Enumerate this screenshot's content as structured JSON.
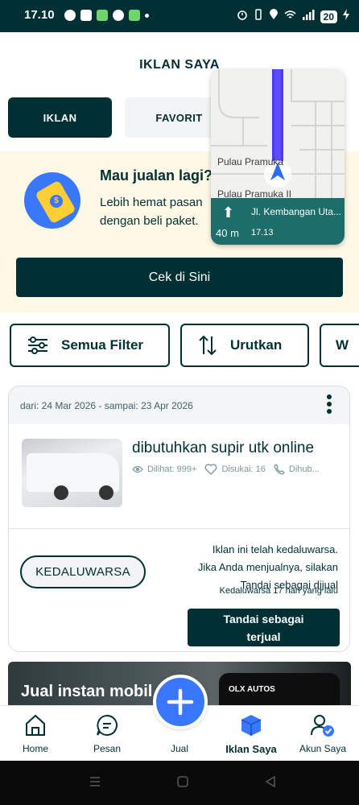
{
  "status_bar": {
    "time": "17.10",
    "battery": "20"
  },
  "header": {
    "title": "IKLAN SAYA"
  },
  "tabs": [
    {
      "label": "IKLAN",
      "active": true
    },
    {
      "label": "FAVORIT",
      "active": false
    }
  ],
  "promo": {
    "title": "Mau jualan lagi?",
    "desc_line1": "Lebih hemat pasan",
    "desc_line2": "dengan beli paket.",
    "coin_symbol": "$",
    "button": "Cek di Sini"
  },
  "map_overlay": {
    "road_1": "Pulau Pramuka",
    "road_2": "Pulau Pramuka II",
    "street": "Jl. Kembangan Uta...",
    "distance": "40 m",
    "eta": "17.13"
  },
  "filters": {
    "all_filter": "Semua Filter",
    "sort": "Urutkan",
    "third": "W"
  },
  "ad": {
    "dates": "dari: 24 Mar 2026 - sampai: 23 Apr 2026",
    "title": "dibutuhkan supir utk online",
    "views": "Dilihat: 999+",
    "likes": "Disukai: 16",
    "calls": "Dihub...",
    "status": "KEDALUWARSA",
    "expired_line1": "Iklan ini telah kedaluwarsa.",
    "expired_line2": "Jika Anda menjualnya, silakan",
    "expired_line3": "Tandai sebagai dijual",
    "expired_ago": "Kedaluwarsa 17 hari yang lalu",
    "mark_sold_line1": "Tandai sebagai",
    "mark_sold_line2": "terjual"
  },
  "banner": {
    "text": "Jual instan mobil",
    "logo": "OLX AUTOS"
  },
  "bottom_nav": [
    {
      "label": "Home",
      "icon": "home-icon"
    },
    {
      "label": "Pesan",
      "icon": "chat-icon"
    },
    {
      "label": "Jual",
      "icon": "plus-icon"
    },
    {
      "label": "Iklan Saya",
      "icon": "box-icon",
      "active": true
    },
    {
      "label": "Akun Saya",
      "icon": "user-check-icon"
    }
  ],
  "colors": {
    "primary": "#002f34",
    "accent_blue": "#3a77ff",
    "promo_bg": "#fef8e6",
    "coin_yellow": "#ffce32"
  }
}
